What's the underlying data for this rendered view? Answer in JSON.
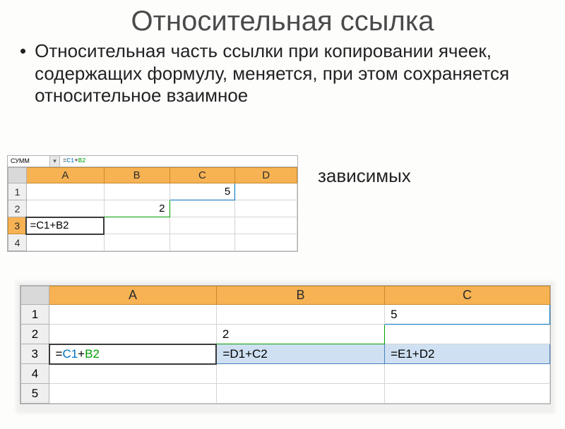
{
  "title": "Относительная ссылка",
  "bullet": "Относительная часть ссылки при копировании ячеек, содержащих формулу, меняется, при этом сохраняется относительное взаимное",
  "right_word": "зависимых",
  "sheet1": {
    "namebox": "СУММ",
    "formula_prefix": "=",
    "formula_ref1": "C1",
    "formula_plus": "+",
    "formula_ref2": "B2",
    "cols": [
      "A",
      "B",
      "C",
      "D"
    ],
    "rows": [
      "1",
      "2",
      "3",
      "4"
    ],
    "c1": "5",
    "b2": "2",
    "a3": "=C1+B2"
  },
  "sheet2": {
    "cols": [
      "A",
      "B",
      "C"
    ],
    "rows": [
      "1",
      "2",
      "3",
      "4",
      "5"
    ],
    "c1": "5",
    "b2": "2",
    "a3_ref1": "C1",
    "a3_ref2": "B2",
    "b3": "=D1+C2",
    "c3": "=E1+D2"
  }
}
